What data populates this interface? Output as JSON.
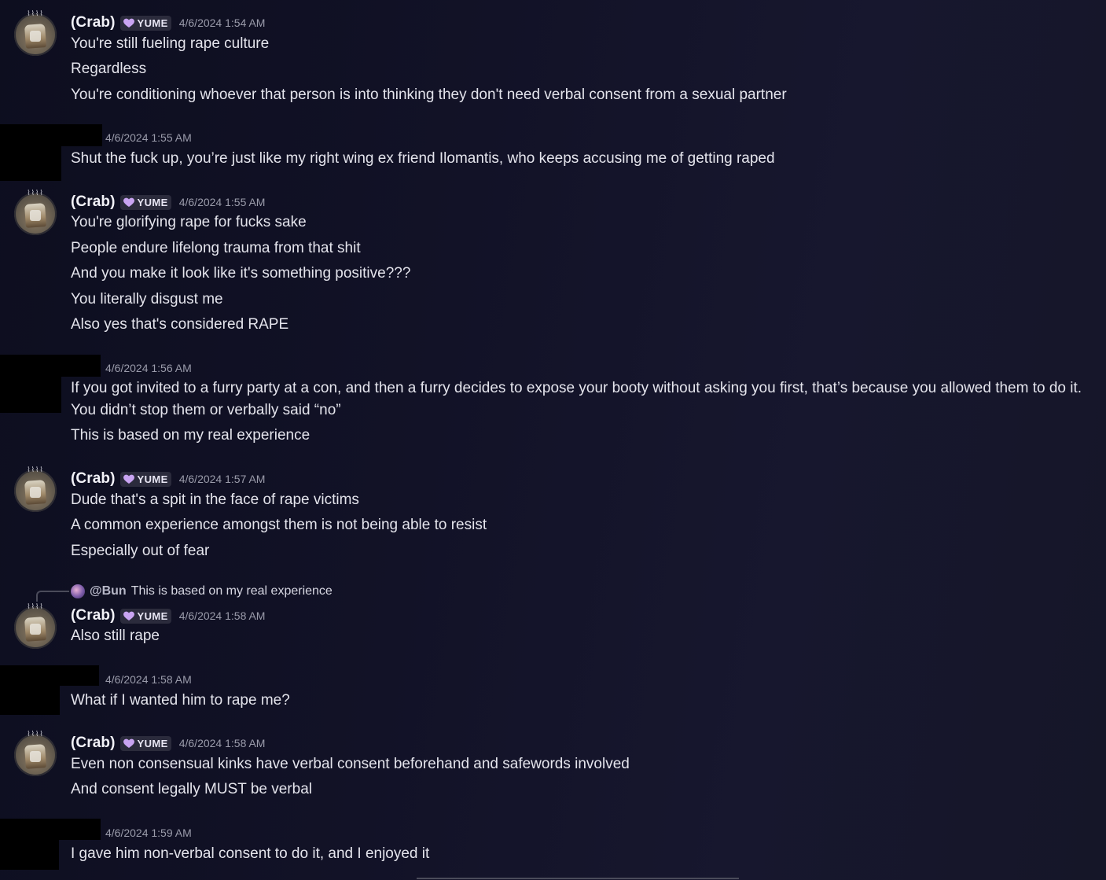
{
  "user_crab": {
    "name": "(Crab)",
    "tag": "YUME",
    "avatar_hat": "⌇⌇⌇⌇"
  },
  "messages": [
    {
      "author": "crab",
      "timestamp": "4/6/2024 1:54 AM",
      "lines": [
        "You're still fueling rape culture",
        "Regardless",
        "You're conditioning whoever that person is into thinking they don't need verbal consent from a sexual partner"
      ]
    },
    {
      "author": "redacted",
      "timestamp": "4/6/2024 1:55 AM",
      "lines": [
        "Shut the fuck up, you’re just like my right wing ex friend Ilomantis, who keeps accusing me of getting raped"
      ]
    },
    {
      "author": "crab",
      "timestamp": "4/6/2024 1:55 AM",
      "lines": [
        "You're glorifying rape for fucks sake",
        "People endure lifelong trauma from that shit",
        "And you make it look like it's something positive???",
        "You literally disgust me",
        "Also yes that's considered RAPE"
      ]
    },
    {
      "author": "redacted",
      "timestamp": "4/6/2024 1:56 AM",
      "lines": [
        "If you got invited to a furry party at a con, and then a furry decides to expose your booty without asking you first, that’s because you allowed them to do it.",
        "You didn’t stop them or verbally said “no”",
        "This is based on my real experience"
      ]
    },
    {
      "author": "crab",
      "timestamp": "4/6/2024 1:57 AM",
      "lines": [
        "Dude that's a spit in the face of rape victims",
        "A common experience amongst them is not being able to resist",
        "Especially out of fear"
      ]
    },
    {
      "author": "crab",
      "timestamp": "4/6/2024 1:58 AM",
      "reply": {
        "mention": "@Bun",
        "text": "This is based on my real experience"
      },
      "lines": [
        "Also still rape"
      ]
    },
    {
      "author": "redacted",
      "timestamp": "4/6/2024 1:58 AM",
      "lines": [
        "What if I wanted him to rape me?"
      ]
    },
    {
      "author": "crab",
      "timestamp": "4/6/2024 1:58 AM",
      "lines": [
        "Even non consensual kinks have verbal consent beforehand and safewords involved",
        "And consent legally MUST be verbal"
      ]
    },
    {
      "author": "redacted",
      "timestamp": "4/6/2024 1:59 AM",
      "lines": [
        "I gave him non-verbal consent to do it, and I enjoyed it"
      ]
    }
  ],
  "colors": {
    "background": "#121227",
    "text": "#e4e4ec",
    "timestamp": "#9b9cab",
    "tag_bg": "#2b2b3c",
    "heart": "#c9a4f2"
  },
  "icons": {
    "tag_icon": "heart-icon",
    "reply_icon": "reply-connector-icon"
  }
}
